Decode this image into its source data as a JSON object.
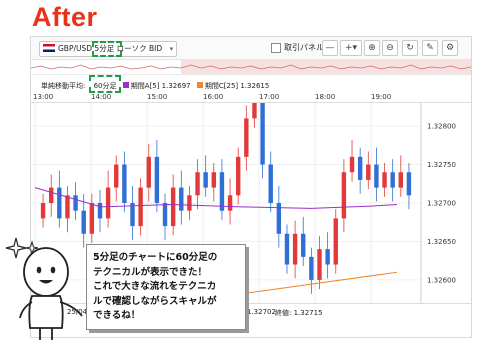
{
  "header": {
    "title": "After"
  },
  "toolbar": {
    "symbol": "GBP/USD 5分足 ローソク BID",
    "trade_panel_label": "取引パネル",
    "buttons": [
      "line-icon",
      "crosshair-icon",
      "zoom-in-icon",
      "zoom-out-icon",
      "refresh-icon",
      "pencil-icon",
      "settings-icon"
    ]
  },
  "legend": {
    "indicator_label": "単純移動平均:",
    "timeframe": "60分足",
    "ma_a": "期間A[5] 1.32697",
    "ma_c": "期間C[25] 1.32615",
    "ma_a_color": "#9b30c8",
    "ma_c_color": "#f0862a"
  },
  "time_axis": [
    "13:00",
    "14:00",
    "15:00",
    "16:00",
    "17:00",
    "18:00",
    "19:00"
  ],
  "price_axis": [
    "1.32800",
    "1.32750",
    "1.32700",
    "1.32650",
    "1.32600"
  ],
  "footer": {
    "date": "25/04",
    "values": "1.32702",
    "close": "終値: 1.32715"
  },
  "bubble": {
    "text": "5分足のチャートに60分足の\nテクニカルが表示できた！\nこれで大きな流れをテクニカ\nルで確認しながらスキャルが\nできるね！"
  },
  "colors": {
    "accent": "#e8331a",
    "up": "#e23a3a",
    "down": "#2f6fd6",
    "highlight": "#1e9e45"
  },
  "chart_data": {
    "type": "candlestick",
    "x_ticks": [
      "13:00",
      "14:00",
      "15:00",
      "16:00",
      "17:00",
      "18:00",
      "19:00"
    ],
    "ylim": [
      1.3257,
      1.3283
    ],
    "closes": [
      1.327,
      1.3272,
      1.3268,
      1.3271,
      1.3269,
      1.3266,
      1.327,
      1.3268,
      1.3272,
      1.3275,
      1.327,
      1.3267,
      1.3272,
      1.3276,
      1.327,
      1.3267,
      1.3272,
      1.3269,
      1.3271,
      1.3274,
      1.3272,
      1.3274,
      1.3269,
      1.3271,
      1.3276,
      1.3281,
      1.3284,
      1.3275,
      1.327,
      1.3266,
      1.3262,
      1.3266,
      1.3263,
      1.326,
      1.3264,
      1.3262,
      1.3268,
      1.3274,
      1.3276,
      1.3273,
      1.3275,
      1.3272,
      1.3274,
      1.3272,
      1.3274,
      1.3271
    ],
    "ma_a": [
      1.3272,
      1.3269
    ],
    "ma_c": [
      1.3258,
      1.3261
    ]
  }
}
